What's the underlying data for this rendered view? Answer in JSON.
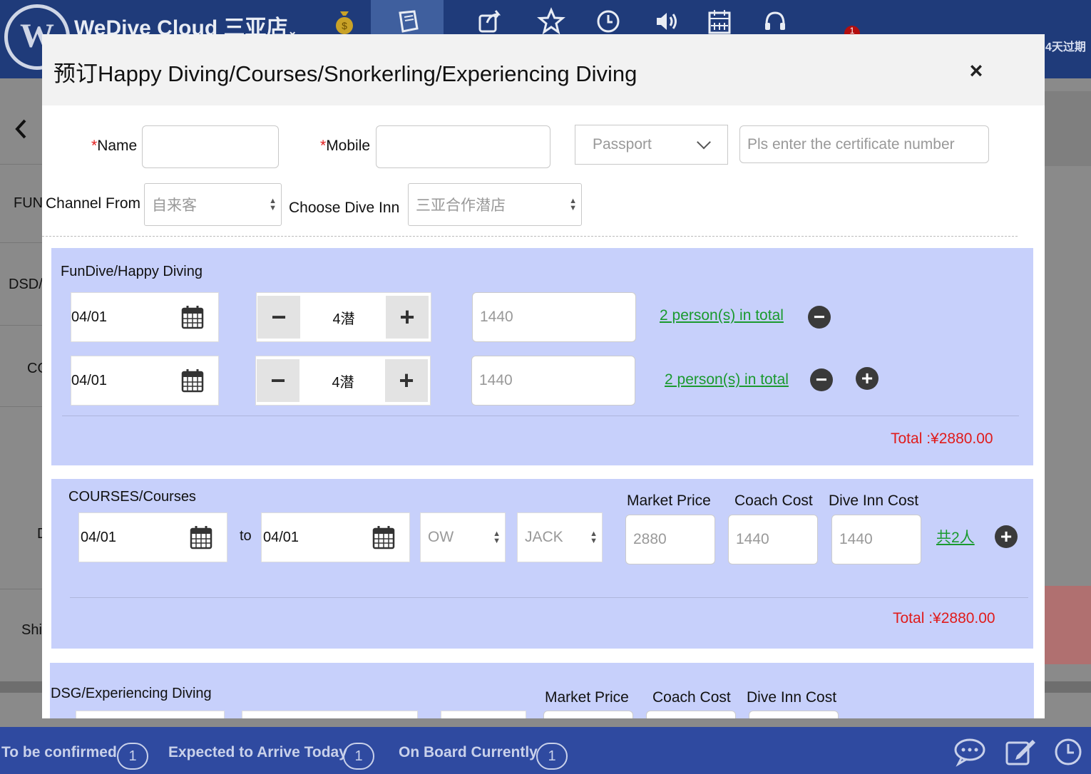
{
  "app": {
    "title": "WeDive Cloud 三亚店",
    "title_caret": "⌄",
    "logo_letter": "W",
    "expire_notice": "4天过期",
    "notification_count": "1"
  },
  "sidebar": {
    "labels": [
      "FUN",
      "DSD/",
      "CO",
      "D",
      "Shi"
    ]
  },
  "footer": {
    "to_be_confirmed_label": "To be confirmed",
    "to_be_confirmed_count": "1",
    "expected_today_label": "Expected to Arrive Today",
    "expected_today_count": "1",
    "on_board_label": "On Board Currently",
    "on_board_count": "1"
  },
  "modal": {
    "title": "预订Happy Diving/Courses/Snorkerling/Experiencing Diving",
    "close_symbol": "×",
    "form": {
      "name_label": "Name",
      "mobile_label": "Mobile",
      "required_mark": "*",
      "id_type_value": "Passport",
      "certificate_placeholder": "Pls enter the certificate number",
      "channel_label": "Channel From",
      "channel_value": "自来客",
      "dive_inn_label": "Choose Dive Inn",
      "dive_inn_value": "三亚合作潜店"
    },
    "fundive": {
      "title": "FunDive/Happy Diving",
      "rows": [
        {
          "date": "04/01",
          "dives": "4潜",
          "price": "1440",
          "persons": "2 person(s) in total"
        },
        {
          "date": "04/01",
          "dives": "4潜",
          "price": "1440",
          "persons": "2 person(s) in total"
        }
      ],
      "total": "Total :¥2880.00"
    },
    "courses": {
      "title": "COURSES/Courses",
      "market_price_label": "Market Price",
      "coach_cost_label": "Coach Cost",
      "dive_inn_cost_label": "Dive Inn Cost",
      "start_date": "04/01",
      "to_label": "to",
      "end_date": "04/01",
      "course_value": "OW",
      "coach_value": "JACK",
      "market_price": "2880",
      "coach_cost": "1440",
      "dive_inn_cost": "1440",
      "persons": "共2人",
      "total": "Total :¥2880.00"
    },
    "dsg": {
      "title": "DSG/Experiencing Diving",
      "market_price_label": "Market Price",
      "coach_cost_label": "Coach Cost",
      "dive_inn_cost_label": "Dive Inn Cost"
    }
  },
  "colors": {
    "topbar": "#1f3b7a",
    "footer": "#2f4aa0",
    "section_bg": "#c7d0fb",
    "accent_green": "#1a9a2e",
    "total_red": "#e01b1b"
  }
}
